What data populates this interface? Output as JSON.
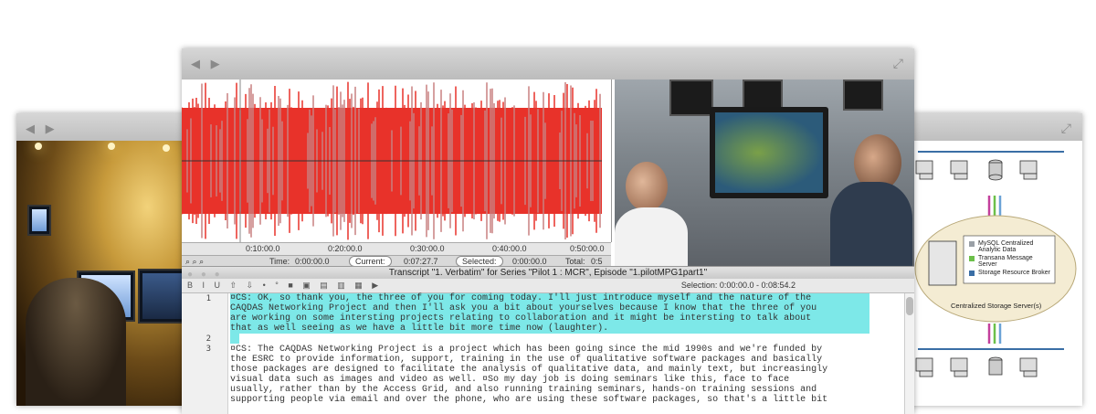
{
  "windows": {
    "left": {
      "nav_icons": "◀ ▶",
      "expand_icon": "⤢"
    },
    "center": {
      "nav_icons": "◀ ▶",
      "expand_icon": "⤢"
    },
    "right": {
      "expand_icon": "⤢"
    }
  },
  "waveform": {
    "color": "#e8322a",
    "ruler_ticks": [
      "0:10:00.0",
      "0:20:00.0",
      "0:30:00.0",
      "0:40:00.0",
      "0:50:00.0"
    ],
    "status": {
      "time_label": "Time:",
      "time_value": "0:00:00.0",
      "current_label": "Current:",
      "current_value": "0:07:27.7",
      "selected_label": "Selected:",
      "selected_value": "0:00:00.0",
      "total_label": "Total:",
      "total_value": "0:5"
    }
  },
  "transcript": {
    "title": "Transcript \"1. Verbatim\" for Series \"Pilot 1 : MCR\", Episode \"1.pilotMPG1part1\"",
    "toolbar_tools": "B I U ⇧ ⇩ • ° ■ ▣ ▤ ▥ ▦ ▶",
    "selection_label": "Selection:",
    "selection_value": "0:00:00.0 - 0:08:54.2",
    "line_numbers": [
      "1",
      "2",
      "3"
    ],
    "paragraph1": [
      "¤CS: OK, so thank you, the three of you for coming today. I'll just introduce myself and the nature of the",
      "CAQDAS Networking Project and then I'll ask you a bit about yourselves because I know that the three of you",
      "are working on some intersting projects relating to collaboration and it might be intersting to talk about",
      "that as well seeing as we have a little bit more time now (laughter)."
    ],
    "paragraph3": [
      "¤CS: The CAQDAS Networking Project is a project which has been going since the mid 1990s and we're funded by",
      "the ESRC to provide information, support, training in the use of qualitative software packages and basically",
      "those packages are designed to facilitate the analysis of qualitative data, and mainly text, but increasingly",
      "visual data such as images and video as well. ¤So my day job is doing seminars like this, face to face",
      "usually, rather than by the Access Grid, and also running training seminars, hands-on training sessions and",
      "supporting people via email and over the phone, who are using these software packages, so that's a little bit"
    ]
  },
  "diagram": {
    "legend": [
      "MySQL Centralized Analytic Data",
      "Transana Message Server",
      "Storage Resource Broker"
    ],
    "caption": "Centralized Storage Server(s)"
  }
}
